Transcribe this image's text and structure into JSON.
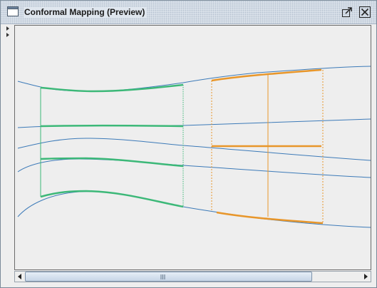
{
  "window": {
    "title": "Conformal Mapping (Preview)",
    "icon": "window-frame-icon",
    "buttons": [
      {
        "name": "float-window-button",
        "icon": "undock-arrow-icon"
      },
      {
        "name": "close-window-button",
        "icon": "close-x-icon"
      }
    ]
  },
  "plot": {
    "description_colors": {
      "grid_lines": "#3c7ab8",
      "left_region": "#3cb878",
      "right_region": "#e8962a",
      "background": "#eeeeee"
    }
  },
  "scrollbar": {
    "orientation": "horizontal",
    "left_arrow_icon": "triangle-left-icon",
    "right_arrow_icon": "triangle-right-icon",
    "thumb_fraction": 0.86
  }
}
